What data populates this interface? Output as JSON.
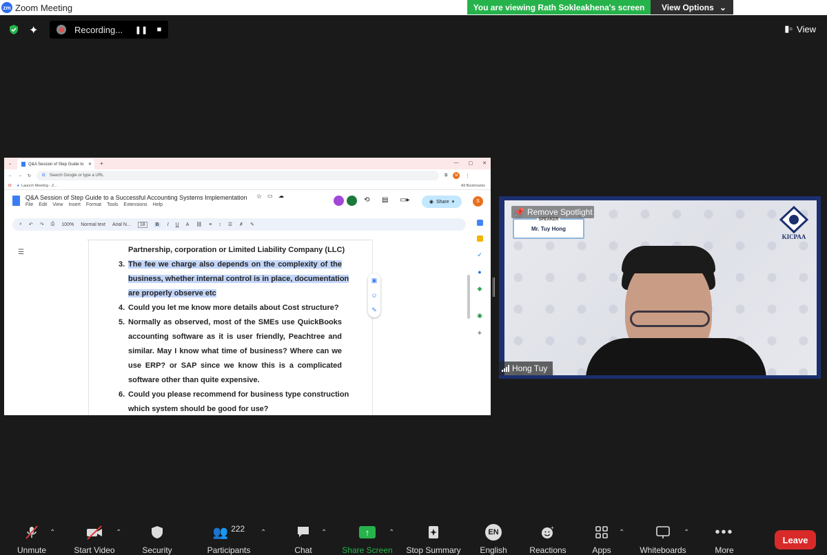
{
  "window": {
    "title": "Zoom Meeting"
  },
  "banner": {
    "viewing_text": "You are viewing Rath Sokleakhena's screen",
    "view_options_label": "View Options"
  },
  "top_bar": {
    "recording_label": "Recording...",
    "view_label": "View"
  },
  "shared_screen": {
    "browser": {
      "tab_title": "Q&A Session of Step Guide to",
      "address_placeholder": "Search Google or type a URL",
      "bookmark_item": "Launch Meeting - Z...",
      "all_bookmarks": "All Bookmarks",
      "profile_initial": "M"
    },
    "docs": {
      "title": "Q&A Session of Step Guide to a Successful Accounting Systems Implementation",
      "menu": [
        "File",
        "Edit",
        "View",
        "Insert",
        "Format",
        "Tools",
        "Extensions",
        "Help"
      ],
      "share_label": "Share",
      "avatar_initial": "S",
      "zoom": "100%",
      "style": "Normal text",
      "font": "Arial N...",
      "font_size": "18"
    },
    "content": {
      "line_1": "Partnership, corporation or Limited Liability Company (LLC)",
      "item3_num": "3.",
      "item3_l1": "The fee we charge also depends on the complexity of the",
      "item3_l2": "business, whether internal control is in place, documentation",
      "item3_l3": "are properly observe etc",
      "item4_num": "4.",
      "item4_l1": "Could you let me know more details about Cost structure?",
      "item5_num": "5.",
      "item5_l1": "Normally as observed, most of the SMEs use QuickBooks",
      "item5_l2": "accounting software as it is user friendly, Peachtree and",
      "item5_l3": "similar.  May I know what time of business? Where can we",
      "item5_l4": "use ERP? or SAP since we know this is a complicated",
      "item5_l5": "software other than quite expensive.",
      "item6_num": "6.",
      "item6_l1": "Could you please recommend for business type construction",
      "item6_l2": "which system should be good for use?"
    }
  },
  "video": {
    "remove_spotlight": "Remove Spotlight",
    "speaker_role": "SPEAKER",
    "speaker_name": "Mr. Tuy Hong",
    "logo_text": "KICPAA",
    "participant_name": "Hong Tuy"
  },
  "toolbar": {
    "unmute": "Unmute",
    "start_video": "Start Video",
    "security": "Security",
    "participants": "Participants",
    "participants_count": "222",
    "chat": "Chat",
    "share_screen": "Share Screen",
    "stop_summary": "Stop Summary",
    "language_code": "EN",
    "english": "English",
    "reactions": "Reactions",
    "apps": "Apps",
    "whiteboards": "Whiteboards",
    "more": "More",
    "leave": "Leave"
  },
  "colors": {
    "banner_green": "#26b34b",
    "leave_red": "#d92a2a",
    "highlight": "#c3d5f8"
  }
}
